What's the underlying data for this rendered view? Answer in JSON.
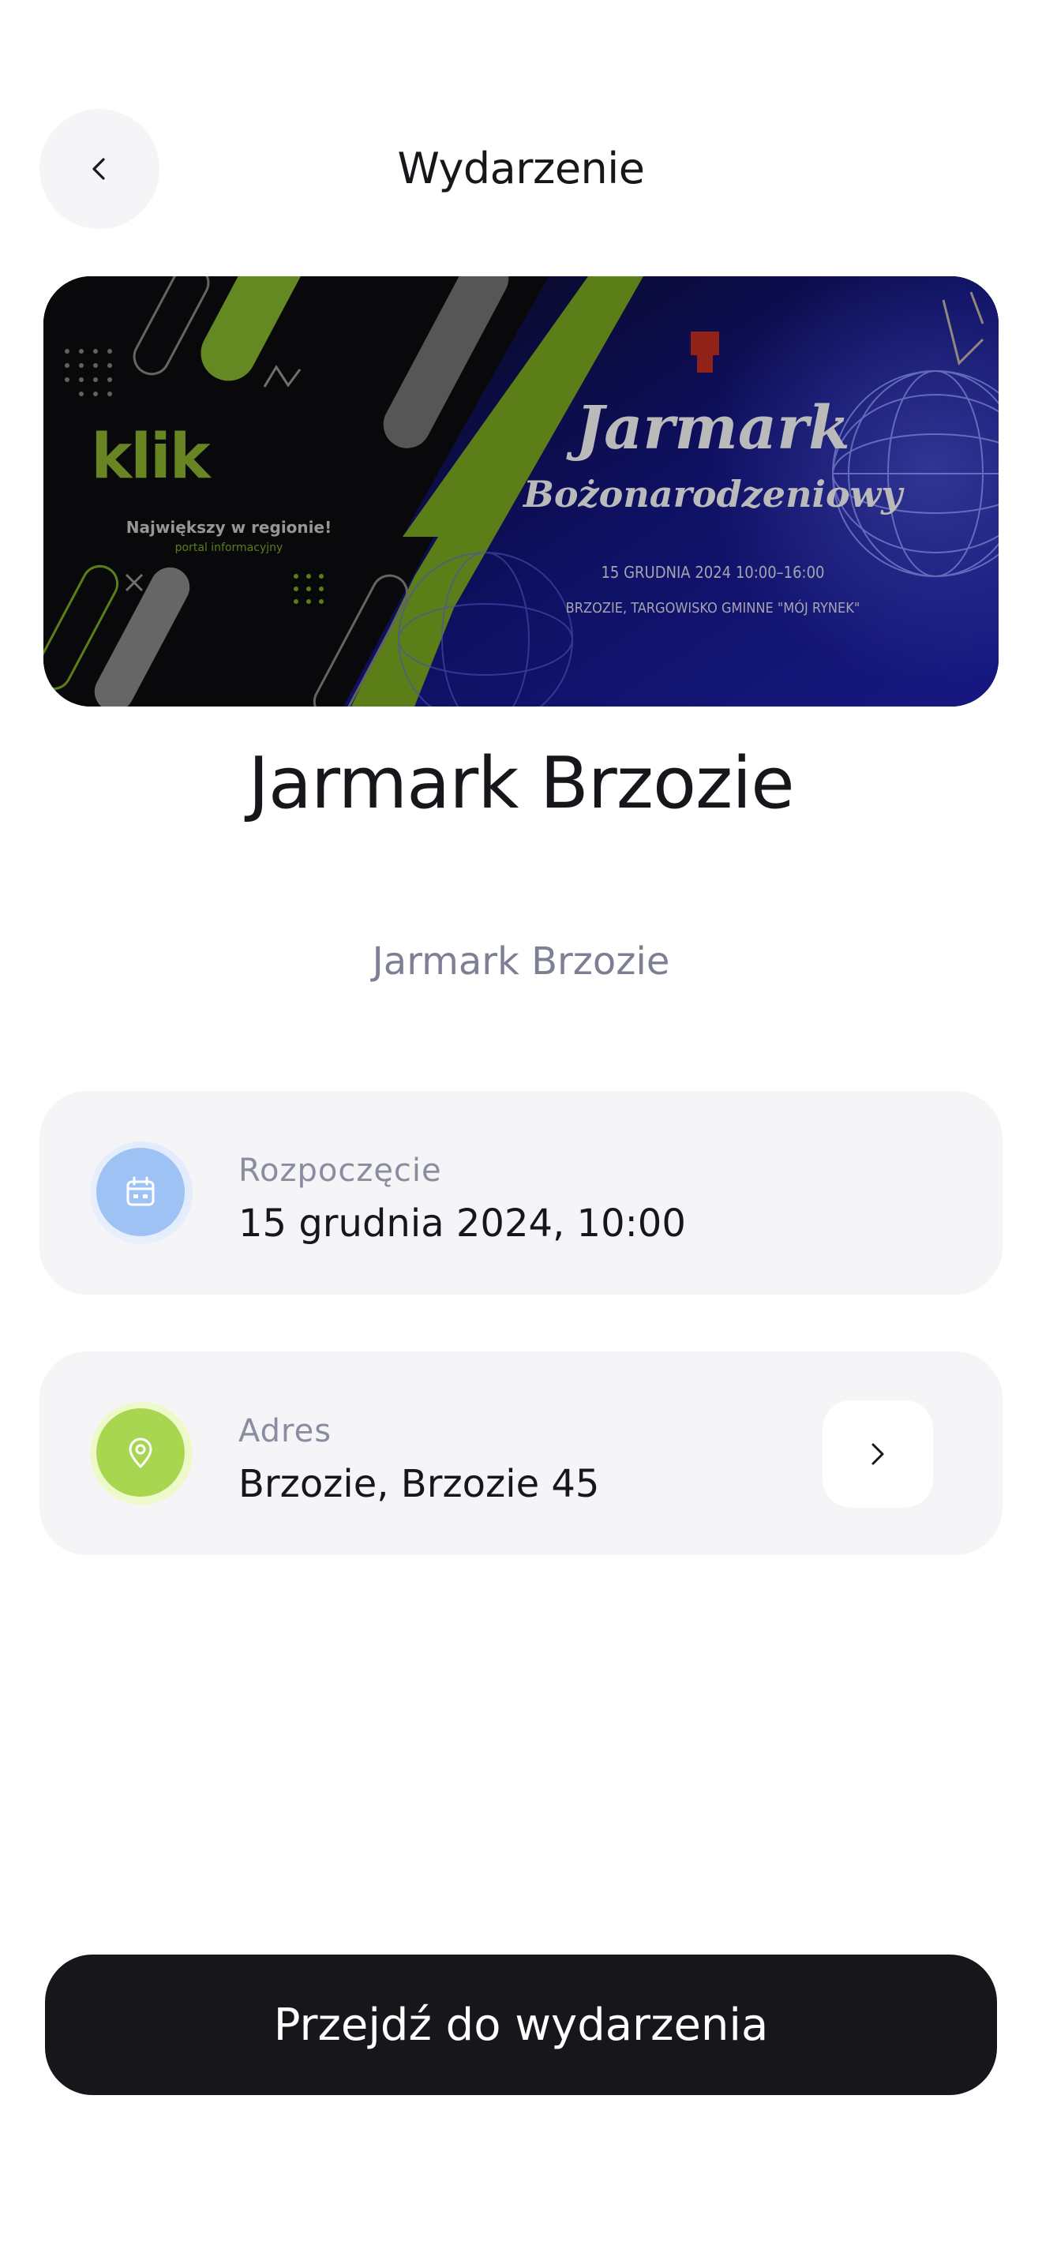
{
  "header": {
    "title": "Wydarzenie",
    "back_icon": "chevron-left-icon"
  },
  "banner": {
    "logo_text": "klik",
    "logo_tagline": "Największy w regionie!",
    "logo_subtagline": "portal informacyjny",
    "headline_line1": "Jarmark",
    "headline_line2": "Bożonarodzeniowy",
    "date_line": "15 GRUDNIA 2024 10:00–16:00",
    "place_line": "BRZOZIE, TARGOWISKO GMINNE \"MÓJ RYNEK\"",
    "colors": {
      "green": "#8cbf26",
      "navy": "#0d1170",
      "dark": "#0b0c0f"
    }
  },
  "event": {
    "title": "Jarmark Brzozie",
    "description": "Jarmark Brzozie"
  },
  "start": {
    "label": "Rozpoczęcie",
    "value": "15 grudnia 2024, 10:00",
    "icon": "calendar-icon",
    "icon_color": "#9fc2f5"
  },
  "address": {
    "label": "Adres",
    "value": "Brzozie, Brzozie 45",
    "icon": "location-pin-icon",
    "icon_color": "#a9d651",
    "action_icon": "chevron-right-icon"
  },
  "cta": {
    "label": "Przejdź do wydarzenia"
  }
}
